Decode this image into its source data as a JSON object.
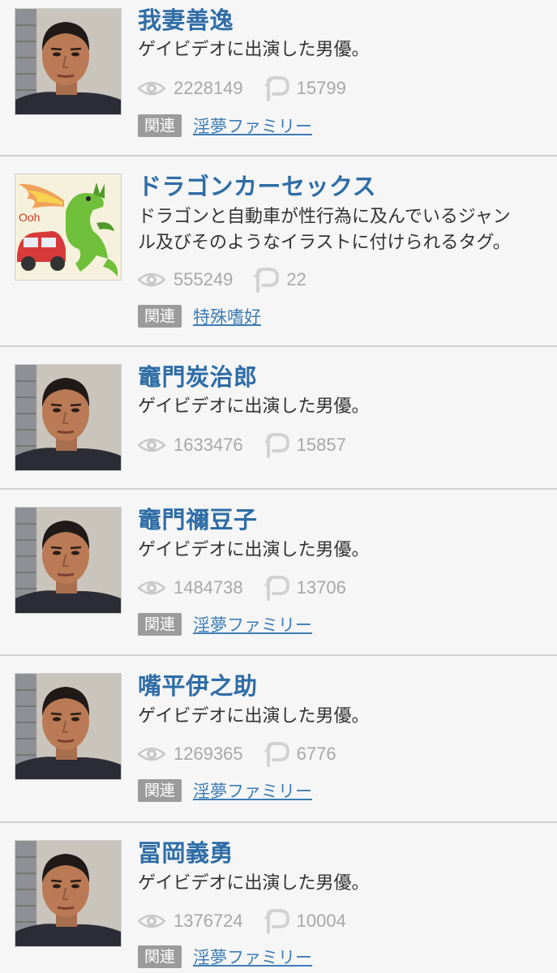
{
  "labels": {
    "related_badge": "関連"
  },
  "items": [
    {
      "title": "我妻善逸",
      "desc_line1": "ゲイビデオに出演した男優。",
      "desc_line2": "",
      "views": "2228149",
      "pixiv_count": "15799",
      "related_tag": "淫夢ファミリー",
      "thumbnail": "man-portrait"
    },
    {
      "title": "ドラゴンカーセックス",
      "desc_line1": "ドラゴンと自動車が性行為に及んでいるジャン",
      "desc_line2": "ル及びそのようなイラストに付けられるタグ。",
      "views": "555249",
      "pixiv_count": "22",
      "related_tag": "特殊嗜好",
      "thumbnail": "dragon-car-illustration"
    },
    {
      "title": "竈門炭治郎",
      "desc_line1": "ゲイビデオに出演した男優。",
      "desc_line2": "",
      "views": "1633476",
      "pixiv_count": "15857",
      "related_tag": "",
      "thumbnail": "man-portrait"
    },
    {
      "title": "竈門禰豆子",
      "desc_line1": "ゲイビデオに出演した男優。",
      "desc_line2": "",
      "views": "1484738",
      "pixiv_count": "13706",
      "related_tag": "淫夢ファミリー",
      "thumbnail": "man-portrait"
    },
    {
      "title": "嘴平伊之助",
      "desc_line1": "ゲイビデオに出演した男優。",
      "desc_line2": "",
      "views": "1269365",
      "pixiv_count": "6776",
      "related_tag": "淫夢ファミリー",
      "thumbnail": "man-portrait"
    },
    {
      "title": "冨岡義勇",
      "desc_line1": "ゲイビデオに出演した男優。",
      "desc_line2": "",
      "views": "1376724",
      "pixiv_count": "10004",
      "related_tag": "淫夢ファミリー",
      "thumbnail": "man-portrait"
    }
  ]
}
